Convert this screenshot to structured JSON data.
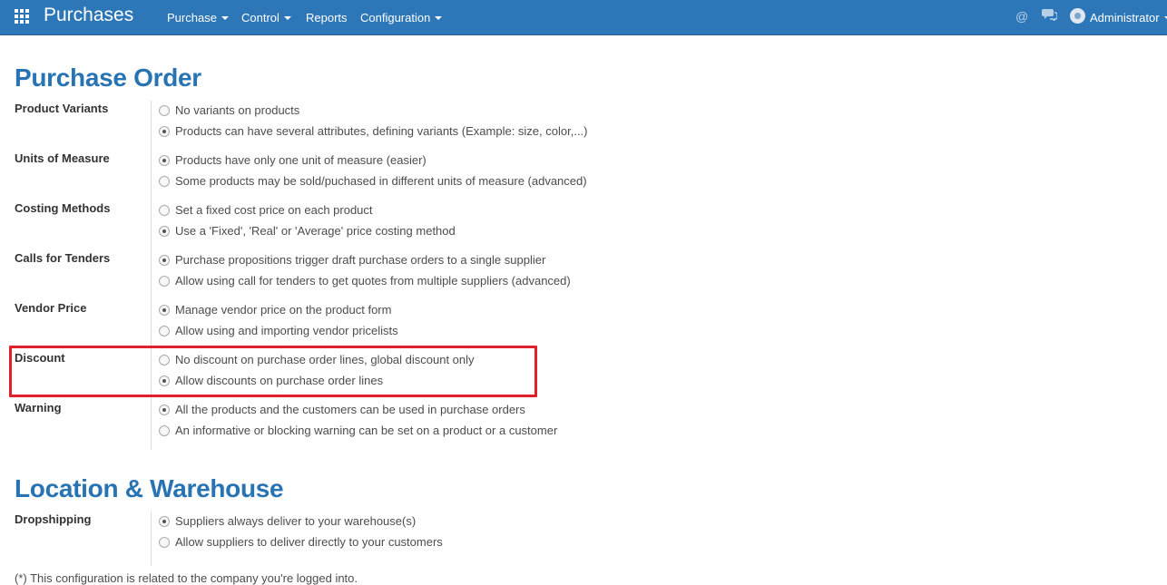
{
  "navbar": {
    "app_title": "Purchases",
    "menus": [
      {
        "label": "Purchase"
      },
      {
        "label": "Control"
      },
      {
        "label": "Reports"
      },
      {
        "label": "Configuration"
      }
    ],
    "user_name": "Administrator"
  },
  "sections": [
    {
      "title": "Purchase Order",
      "groups": [
        {
          "label": "Product Variants",
          "options": [
            {
              "text": "No variants on products",
              "selected": false
            },
            {
              "text": "Products can have several attributes, defining variants (Example: size, color,...)",
              "selected": true
            }
          ]
        },
        {
          "label": "Units of Measure",
          "options": [
            {
              "text": "Products have only one unit of measure (easier)",
              "selected": true
            },
            {
              "text": "Some products may be sold/puchased in different units of measure (advanced)",
              "selected": false
            }
          ]
        },
        {
          "label": "Costing Methods",
          "options": [
            {
              "text": "Set a fixed cost price on each product",
              "selected": false
            },
            {
              "text": "Use a 'Fixed', 'Real' or 'Average' price costing method",
              "selected": true
            }
          ]
        },
        {
          "label": "Calls for Tenders",
          "options": [
            {
              "text": "Purchase propositions trigger draft purchase orders to a single supplier",
              "selected": true
            },
            {
              "text": "Allow using call for tenders to get quotes from multiple suppliers (advanced)",
              "selected": false
            }
          ]
        },
        {
          "label": "Vendor Price",
          "options": [
            {
              "text": "Manage vendor price on the product form",
              "selected": true
            },
            {
              "text": "Allow using and importing vendor pricelists",
              "selected": false
            }
          ]
        },
        {
          "label": "Discount",
          "options": [
            {
              "text": "No discount on purchase order lines, global discount only",
              "selected": false
            },
            {
              "text": "Allow discounts on purchase order lines",
              "selected": true
            }
          ]
        },
        {
          "label": "Warning",
          "options": [
            {
              "text": "All the products and the customers can be used in purchase orders",
              "selected": true
            },
            {
              "text": "An informative or blocking warning can be set on a product or a customer",
              "selected": false
            }
          ]
        }
      ]
    },
    {
      "title": "Location & Warehouse",
      "groups": [
        {
          "label": "Dropshipping",
          "options": [
            {
              "text": "Suppliers always deliver to your warehouse(s)",
              "selected": true
            },
            {
              "text": "Allow suppliers to deliver directly to your customers",
              "selected": false
            }
          ]
        }
      ]
    }
  ],
  "footnote": "(*) This configuration is related to the company you're logged into.",
  "colors": {
    "navbar": "#2d76b7",
    "heading": "#2873b3",
    "highlight": "#e0202a"
  }
}
